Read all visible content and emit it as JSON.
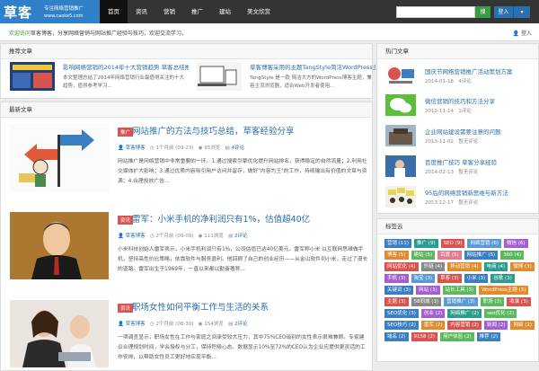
{
  "logo": {
    "main": "草客",
    "tagline": "专注网络营销推广",
    "url": "www.caoke5.com"
  },
  "nav": [
    "首页",
    "资讯",
    "营销",
    "推广",
    "建站",
    "美文欣赏"
  ],
  "search": {
    "placeholder": "",
    "button": "搜"
  },
  "user_menu": {
    "label": "登入"
  },
  "notice": {
    "highlight": "欢迎访问",
    "text": "草客博客，分享网络营销与网站推广经验与技巧，欢迎交流学习。",
    "login": "登入"
  },
  "featured": {
    "title": "推荐文章",
    "items": [
      {
        "title": "影响网络营销的2014年十大营销趋势 草客总结推荐",
        "text": "本文整理总结了2014年网络营销行业最值得关注的十大趋势，值得参考学习..."
      },
      {
        "title": "草客博客采用的主题TangStyle简洁WordPress主题",
        "text": "TangStyle 是一款 简洁大方的WordPress博客主题，兼容主流浏览器，适合Web开发者使用..."
      }
    ]
  },
  "latest": {
    "title": "最新文章",
    "articles": [
      {
        "badge": "推广",
        "title": "网站推广的方法与技巧总结，草客经验分享",
        "user": "草客博客",
        "date": "1个月前 (09-23)",
        "views": "95浏览",
        "comments": "4评论",
        "desc": "网站推广是网络营销中非常重要的一环。1.通过搜索引擎优化提升网站排名，获得稳定的自然流量；2.利用社交媒体扩大影响；3.通过优质内容吸引用户访问并留存，做好\"内容为王\"的工作，持续输出有价值的文章与资源；4.合理投放广告..."
      },
      {
        "badge": "资讯",
        "title": "雷军：小米手机的净利润只有1%，估值超40亿",
        "user": "草客博客",
        "date": "2个月前 (09-09)",
        "views": "111浏览",
        "comments": "2评论",
        "desc": "小米科技创始人雷军表示，小米手机利润只有1%，公司估值已达40亿美元。雷军称小米 以互联网思维做手机，坚持高性价比策略，依靠软件与服务盈利。他回顾了自己的创业经历——从金山软件到小米，走过了漫长的道路。雷军出生于1969年，一直以来都以勤奋著称..."
      },
      {
        "badge": "资讯",
        "title": "职场女性如何平衡工作与生活的关系",
        "user": "草客博客",
        "date": "2个月前 (08-30)",
        "views": "154浏览",
        "comments": "2评论",
        "desc": "一项调查显示，职场女性在工作与家庭之间承受较大压力，其中75%CEO级别的女性表示很难兼顾。专家建议合理规划时间，学会授权与分工，保持积极心态。数据显示10%至72%的CEO认为企业应提供更灵活的工作安排，以帮助女性员工更好地实现平衡..."
      }
    ]
  },
  "hot": {
    "title": "热门文章",
    "items": [
      {
        "title": "国庆节网络营销推广活动策划方案",
        "date": "2014-01-16",
        "count": "4评论"
      },
      {
        "title": "微信营销的技巧和方法分享",
        "date": "2013-11-14",
        "count": "1评论"
      },
      {
        "title": "企业网站建设需要注意的问题",
        "date": "2013-11-02",
        "count": "暂无评论"
      },
      {
        "title": "百度推广技巧 草客分享经验",
        "date": "2014-02-13",
        "count": "暂无评论"
      },
      {
        "title": "95后的网络营销新思维与新方法",
        "date": "2013-12-17",
        "count": "暂无评论"
      }
    ]
  },
  "tagcloud": {
    "title": "标签云",
    "tags": [
      {
        "t": "营销 (11)",
        "c": "#3a7fc1"
      },
      {
        "t": "推广 (9)",
        "c": "#2a9d8f"
      },
      {
        "t": "SEO (9)",
        "c": "#d9534f"
      },
      {
        "t": "网络营销 (6)",
        "c": "#5b9bd5"
      },
      {
        "t": "微信 (6)",
        "c": "#a55fd1"
      },
      {
        "t": "博客 (5)",
        "c": "#e08b2c"
      },
      {
        "t": "建站 (5)",
        "c": "#5cb85c"
      },
      {
        "t": "百度 (5)",
        "c": "#e07b91"
      },
      {
        "t": "网站推广 (5)",
        "c": "#3a7fc1"
      },
      {
        "t": "360 (4)",
        "c": "#5cb85c"
      },
      {
        "t": "网站优化 (4)",
        "c": "#d9534f"
      },
      {
        "t": "外链 (4)",
        "c": "#888888"
      },
      {
        "t": "移动营销 (4)",
        "c": "#e08b2c"
      },
      {
        "t": "电商 (4)",
        "c": "#2a9d8f"
      },
      {
        "t": "微博 (3)",
        "c": "#e08b2c"
      },
      {
        "t": "手机 (3)",
        "c": "#a55fd1"
      },
      {
        "t": "淘宝 (3)",
        "c": "#5b9bd5"
      },
      {
        "t": "草客 (3)",
        "c": "#d9534f"
      },
      {
        "t": "小米 (3)",
        "c": "#3a7fc1"
      },
      {
        "t": "谷歌 (3)",
        "c": "#2a9d8f"
      },
      {
        "t": "关键词 (3)",
        "c": "#3a7fc1"
      },
      {
        "t": "网站 (3)",
        "c": "#a55fd1"
      },
      {
        "t": "站长工具 (3)",
        "c": "#5cb85c"
      },
      {
        "t": "WordPress主题 (3)",
        "c": "#e08b2c"
      },
      {
        "t": "主题 (3)",
        "c": "#d9534f"
      },
      {
        "t": "58同城 (3)",
        "c": "#888888"
      },
      {
        "t": "营销推广 (3)",
        "c": "#5b9bd5"
      },
      {
        "t": "职场 (3)",
        "c": "#5cb85c"
      },
      {
        "t": "收录 (3)",
        "c": "#d9534f"
      },
      {
        "t": "SEO优化 (3)",
        "c": "#3a7fc1"
      },
      {
        "t": "创业 (2)",
        "c": "#a55fd1"
      },
      {
        "t": "网络推广 (2)",
        "c": "#2a9d8f"
      },
      {
        "t": "seo优化 (2)",
        "c": "#5cb85c"
      },
      {
        "t": "SEO技巧 (2)",
        "c": "#3a7fc1"
      },
      {
        "t": "雷军 (2)",
        "c": "#e08b2c"
      },
      {
        "t": "内容营销 (2)",
        "c": "#d9534f"
      },
      {
        "t": "新闻 (2)",
        "c": "#a55fd1"
      },
      {
        "t": "网络 (2)",
        "c": "#e08b2c"
      },
      {
        "t": "域名 (2)",
        "c": "#3a7fc1"
      },
      {
        "t": "9158 (2)",
        "c": "#d9534f"
      },
      {
        "t": "用户体验 (2)",
        "c": "#5cb85c"
      },
      {
        "t": "推荐 (2)",
        "c": "#3a7fc1"
      }
    ]
  }
}
